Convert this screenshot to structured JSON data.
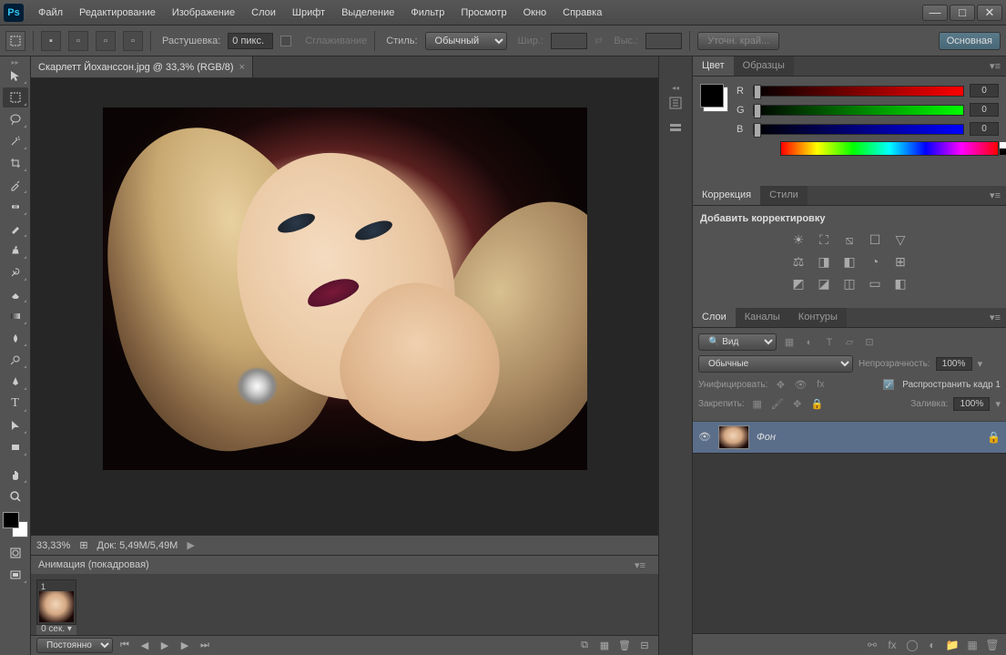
{
  "app": {
    "logo": "Ps"
  },
  "menu": {
    "file": "Файл",
    "edit": "Редактирование",
    "image": "Изображение",
    "layers": "Слои",
    "type": "Шрифт",
    "select": "Выделение",
    "filter": "Фильтр",
    "view": "Просмотр",
    "window": "Окно",
    "help": "Справка"
  },
  "options": {
    "feather_label": "Растушевка:",
    "feather_value": "0 пикс.",
    "antialias": "Сглаживание",
    "style_label": "Стиль:",
    "style_value": "Обычный",
    "width_label": "Шир.:",
    "height_label": "Выс.:",
    "refine": "Уточн. край...",
    "main": "Основная"
  },
  "document": {
    "tab_title": "Скарлетт Йоханссон.jpg @ 33,3% (RGB/8)",
    "zoom": "33,33%",
    "docinfo": "Док: 5,49M/5,49M"
  },
  "animation": {
    "title": "Анимация (покадровая)",
    "frame_duration": "0 сек.",
    "loop": "Постоянно",
    "frame_num": "1"
  },
  "panels": {
    "color": {
      "tab_color": "Цвет",
      "tab_swatches": "Образцы",
      "r": "R",
      "g": "G",
      "b": "B",
      "r_val": "0",
      "g_val": "0",
      "b_val": "0"
    },
    "adjust": {
      "tab_adjust": "Коррекция",
      "tab_styles": "Стили",
      "title": "Добавить корректировку"
    },
    "layers": {
      "tab_layers": "Слои",
      "tab_channels": "Каналы",
      "tab_paths": "Контуры",
      "filter": "Вид",
      "blend": "Обычные",
      "opacity_label": "Непрозрачность:",
      "opacity": "100%",
      "unify": "Унифицировать:",
      "propagate": "Распространить кадр 1",
      "lock_label": "Закрепить:",
      "fill_label": "Заливка:",
      "fill": "100%",
      "layer_name": "Фон"
    }
  }
}
